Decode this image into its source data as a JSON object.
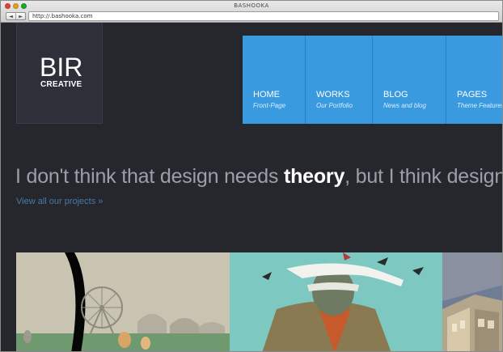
{
  "browser": {
    "title": "BASHOOKA",
    "url": "http://.bashooka.com",
    "back_icon": "◄",
    "forward_icon": "►"
  },
  "logo": {
    "main": "BIR",
    "sub": "CREATIVE"
  },
  "menu": [
    {
      "label": "HOME",
      "sub": "Front-Page"
    },
    {
      "label": "WORKS",
      "sub": "Our Portfolio"
    },
    {
      "label": "BLOG",
      "sub": "News and blog"
    },
    {
      "label": "PAGES",
      "sub": "Theme Features"
    }
  ],
  "hero": {
    "text_before": "I don't think that design needs ",
    "text_bold": "theory",
    "text_after": ", but I think designers",
    "link": "View all our projects »"
  },
  "colors": {
    "page_bg": "#25272d",
    "tile_blue": "#3a9ae0",
    "link_blue": "#4a78a6"
  }
}
